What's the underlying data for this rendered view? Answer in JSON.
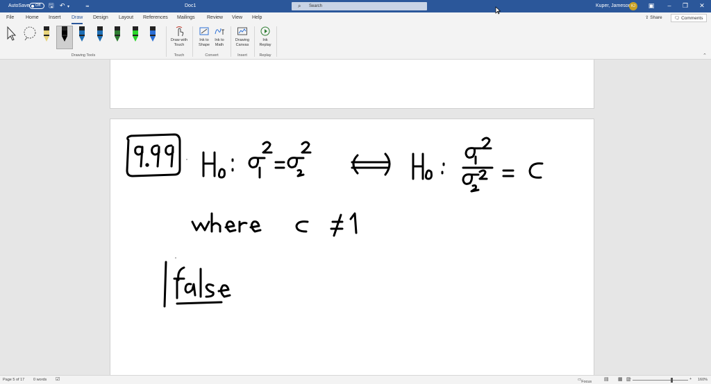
{
  "titlebar": {
    "autosave_label": "AutoSave",
    "autosave_state": "Off",
    "doc_title": "Doc1",
    "search_placeholder": "Search",
    "user_name": "Kuper, Jameson",
    "user_initials": "KJ"
  },
  "ribbon": {
    "tabs": [
      "File",
      "Home",
      "Insert",
      "Draw",
      "Design",
      "Layout",
      "References",
      "Mailings",
      "Review",
      "View",
      "Help"
    ],
    "active_tab": "Draw",
    "share_label": "Share",
    "comments_label": "Comments",
    "groups": {
      "drawing_tools": "Drawing Tools",
      "touch": "Touch",
      "convert": "Convert",
      "insert": "Insert",
      "replay": "Replay"
    },
    "buttons": {
      "draw_with_touch_1": "Draw with",
      "draw_with_touch_2": "Touch",
      "ink_to_shape_1": "Ink to",
      "ink_to_shape_2": "Shape",
      "ink_to_math_1": "Ink to",
      "ink_to_math_2": "Math",
      "drawing_canvas_1": "Drawing",
      "drawing_canvas_2": "Canvas",
      "ink_replay_1": "Ink",
      "ink_replay_2": "Replay"
    },
    "pen_colors": [
      "#e7d37a",
      "#000000",
      "#1f6fb5",
      "#1f6fb5",
      "#2e7d32",
      "#2bd62b",
      "#2b6fd6"
    ]
  },
  "status": {
    "page": "Page 5 of 17",
    "words": "0 words",
    "focus": "Focus",
    "zoom": "160%"
  }
}
